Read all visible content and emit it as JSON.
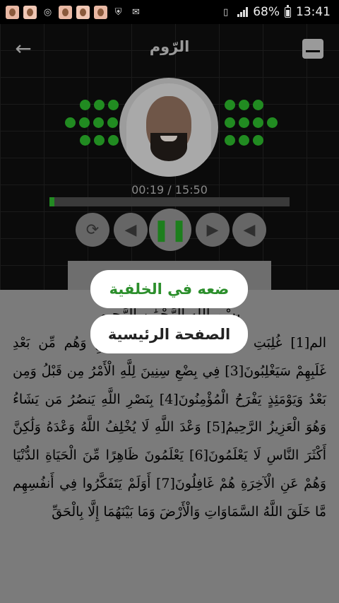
{
  "status_bar": {
    "notification_icons": [
      "contact-photo-icon",
      "contact-photo-icon",
      "sync-icon",
      "contact-photo-icon",
      "contact-photo-icon",
      "contact-photo-icon",
      "shield-icon",
      "email-icon"
    ],
    "battery": "68%",
    "time": "13:41"
  },
  "header": {
    "title": "الرّوم",
    "back_icon": "arrow-left-icon",
    "menu_icon": "menu-icon"
  },
  "player": {
    "position": "00:19",
    "duration": "15:50",
    "time_display": "00:19 / 15:50",
    "progress_fraction": 0.02,
    "controls": [
      "repeat-icon",
      "previous-icon",
      "pause-icon",
      "next-icon",
      "volume-icon"
    ],
    "accent_color": "#238a23"
  },
  "surah_text": {
    "basmala": "بِسْمِ اللَّهِ الرَّحْمَٰنِ الرَّحِيمِ",
    "ayahs_text": "الم[1] غُلِبَتِ الرُّومُ[2] فِي أَدْنَى الْأَرْضِ وَهُم مِّن بَعْدِ غَلَبِهِمْ سَيَغْلِبُونَ[3] فِي بِضْعِ سِنِينَ لِلَّهِ الْأَمْرُ مِن قَبْلُ وَمِن بَعْدُ وَيَوْمَئِذٍ يَفْرَحُ الْمُؤْمِنُونَ[4] بِنَصْرِ اللَّهِ يَنصُرُ مَن يَشَاءُ وَهُوَ الْعَزِيزُ الرَّحِيمُ[5] وَعْدَ اللَّهِ لَا يُخْلِفُ اللَّهُ وَعْدَهُ وَلَٰكِنَّ أَكْثَرَ النَّاسِ لَا يَعْلَمُونَ[6] يَعْلَمُونَ ظَاهِرًا مِّنَ الْحَيَاةِ الدُّنْيَا وَهُمْ عَنِ الْآخِرَةِ هُمْ غَافِلُونَ[7] أَوَلَمْ يَتَفَكَّرُوا فِي أَنفُسِهِم مَّا خَلَقَ اللَّهُ السَّمَاوَاتِ وَالْأَرْضَ وَمَا بَيْنَهُمَا إِلَّا بِالْحَقِّ"
  },
  "popup": {
    "background_label": "ضعه في الخلفية",
    "home_label": "الصفحة الرئيسية"
  }
}
